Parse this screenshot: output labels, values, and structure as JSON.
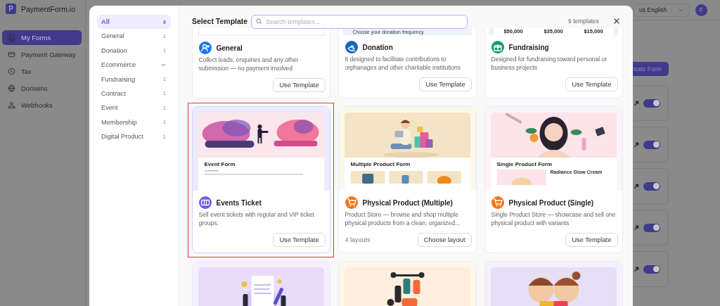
{
  "app": {
    "logo_letter": "P",
    "name": "PaymentForm.io",
    "nav": [
      {
        "label": "My Forms",
        "selected": true
      },
      {
        "label": "Payment Gateway",
        "selected": false
      },
      {
        "label": "Tax",
        "selected": false
      },
      {
        "label": "Domains",
        "selected": false
      },
      {
        "label": "Webhooks",
        "selected": false
      }
    ],
    "language": "us English",
    "avatar": "F",
    "create_button": "reate Form",
    "form_rows": [
      {
        "on": true
      },
      {
        "on": true
      },
      {
        "on": true
      },
      {
        "on": true
      },
      {
        "on": true
      }
    ]
  },
  "modal": {
    "title": "Select Template",
    "search": {
      "placeholder": "Search templates..."
    },
    "count": "9 templates",
    "categories": [
      {
        "label": "All",
        "count": "9",
        "selected": true
      },
      {
        "label": "General",
        "count": "1",
        "selected": false
      },
      {
        "label": "Donation",
        "count": "1",
        "selected": false
      },
      {
        "label": "Ecommerce",
        "expanded": false,
        "selected": false
      },
      {
        "label": "Fundraising",
        "count": "1",
        "selected": false
      },
      {
        "label": "Contract",
        "count": "1",
        "selected": false
      },
      {
        "label": "Event",
        "count": "1",
        "selected": false
      },
      {
        "label": "Membership",
        "count": "1",
        "selected": false
      },
      {
        "label": "Digital Product",
        "count": "1",
        "selected": false
      }
    ],
    "templates": [
      {
        "preview": {
          "kind": "strip-plain"
        },
        "title": "General",
        "color": "#1877f2",
        "description": "Collect leads, enquiries and any other submission — no payment involved",
        "button": "Use Template",
        "selected": false
      },
      {
        "preview": {
          "kind": "strip-donation",
          "texts": [
            "Choose your donation frequency"
          ]
        },
        "title": "Donation",
        "color": "#1565c0",
        "description": "It designed to facilitate contributions to orphanages and other charitable institutions",
        "button": "Use Template",
        "selected": false
      },
      {
        "preview": {
          "kind": "strip-amounts",
          "texts": [
            "$50,000",
            "$35,000",
            "$15,000"
          ]
        },
        "title": "Fundraising",
        "color": "#159a6e",
        "description": "Designed for fundraising toward personal or business projects",
        "button": "Use Template",
        "selected": false
      },
      {
        "preview": {
          "kind": "event",
          "heading": "Event Form"
        },
        "title": "Events Ticket",
        "color": "#6c5ce7",
        "description": "Sell event tickets with regular and VIP ticket groups.",
        "button": "Use Template",
        "selected": true
      },
      {
        "preview": {
          "kind": "shopping",
          "heading": "Multiple Product Form"
        },
        "title": "Physical Product (Multiple)",
        "color": "#f97316",
        "description": "Product Store — browse and shop multiple physical products from a clean, organized...",
        "note": "4 layouts",
        "button": "Choose layout",
        "selected": false
      },
      {
        "preview": {
          "kind": "beauty",
          "heading": "Single Product Form",
          "product": "Radiance Glow Cream"
        },
        "title": "Physical Product (Single)",
        "color": "#f97316",
        "description": "Single Product Store — showcase and sell one physical product with variants",
        "button": "Use Template",
        "selected": false
      },
      {
        "preview": {
          "kind": "contract"
        },
        "selected": false
      },
      {
        "preview": {
          "kind": "fitness"
        },
        "selected": false
      },
      {
        "preview": {
          "kind": "comic"
        },
        "selected": false
      }
    ]
  }
}
